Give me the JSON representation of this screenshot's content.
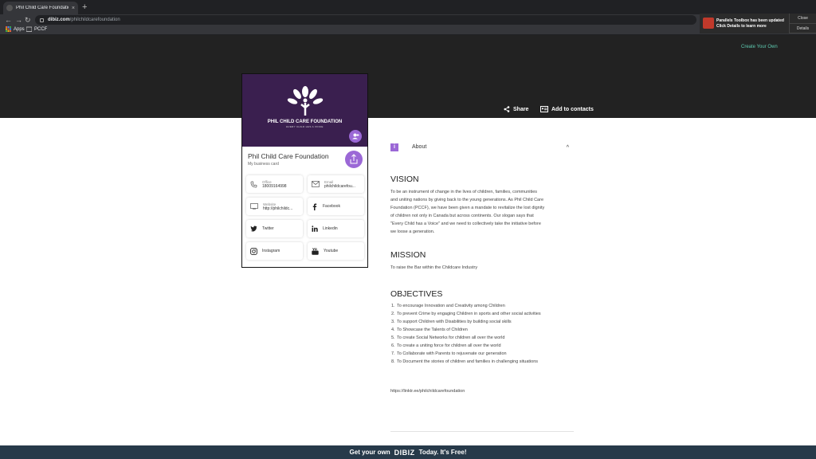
{
  "browser": {
    "tab_title": "Phil Child Care Foundation | Di",
    "tab_close": "×",
    "new_tab": "+",
    "url_host": "dibiz.com",
    "url_path": "/philchildcarefoundation",
    "bookmarks": [
      {
        "label": "Apps"
      },
      {
        "label": "PCCF"
      }
    ]
  },
  "notification": {
    "title": "Parallels Toolbox has been updated",
    "body": "Click Details to learn more",
    "close_label": "Close",
    "details_label": "Details"
  },
  "header": {
    "create_label": "Create Your Own",
    "share_label": "Share",
    "contacts_label": "Add to contacts"
  },
  "card": {
    "brand": "PHIL CHILD CARE FOUNDATION",
    "tagline": "EVERY CHILD HAS A VOICE",
    "name": "Phil Child Care Foundation",
    "subtitle": "My business card",
    "office_label": "Office",
    "office_value": "18009164998",
    "email_label": "Email",
    "email_value": "philchildcarefou...",
    "website_label": "Website",
    "website_value": "http://philchildc...",
    "facebook": "Facebook",
    "twitter": "Twitter",
    "linkedin": "Linkedin",
    "instagram": "Instagram",
    "youtube": "Youtube"
  },
  "about": {
    "label": "About",
    "info_glyph": "i",
    "chevron": "^",
    "vision_title": "VISION",
    "vision_lines": [
      "To be an instrument of change in the lives of children, families, communities",
      "and uniting nations by giving back to the young generations. As Phil Child Care",
      "Foundation (PCCF), we have been given a mandate to revitalize the lost dignity",
      "of children not only in Canada but across continents. Our slogan says that",
      "\"Every Child has a Voice\" and we need to collectively take the initiative before",
      "we loose a generation."
    ],
    "mission_title": "MISSION",
    "mission_text": "To raise the Bar within the Childcare Industry",
    "objectives_title": "OBJECTIVES",
    "objectives": [
      "To encourage Innovation and Creativity among Children",
      "To prevent Crime by engaging Children in sports and other social activities",
      "To support Children with Disabilities by building social skills",
      "To Showcase the Talents of Children",
      "To create Social Networks for children all over the world",
      "To create a uniting force for children all over the world",
      "To Collaborate with Parents to rejuvenate our generation",
      "To Document the stories of children and families in challenging situations"
    ],
    "objective_numbers": [
      "1.",
      "2.",
      "3.",
      "4.",
      "5.",
      "6.",
      "7.",
      "8."
    ],
    "link": "https://linktr.ee/philchildcarefoundation"
  },
  "footer": {
    "prefix": "Get your own",
    "brand": "DIBIZ",
    "suffix": "Today. It's Free!"
  },
  "colors": {
    "accent": "#9b68d6",
    "card_header": "#3a1f4f",
    "hero": "#222222",
    "footer": "#273a4a",
    "create_link": "#5ecbb1"
  }
}
